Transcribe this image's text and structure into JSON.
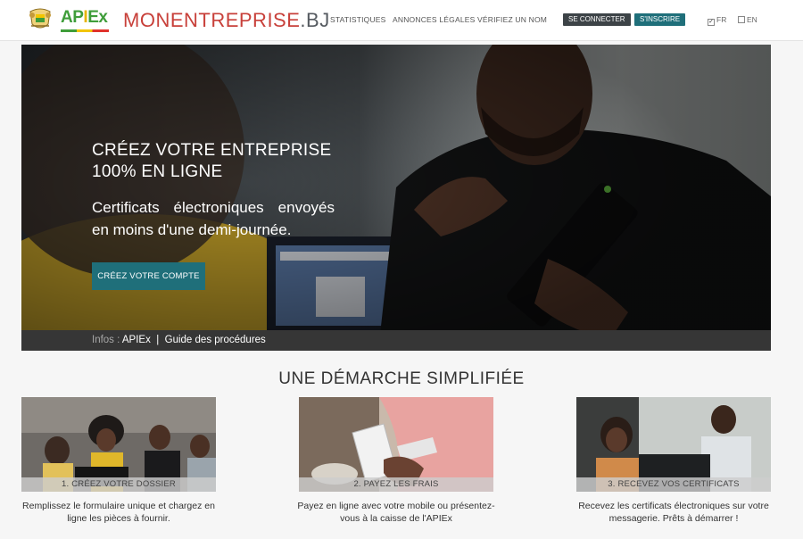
{
  "header": {
    "partner_logo_text": "APIEx",
    "brand_main": "MONENTREPRISE",
    "brand_tld": ".BJ",
    "nav": [
      "STATISTIQUES",
      "ANNONCES LÉGALES",
      "VÉRIFIEZ UN NOM"
    ],
    "login_label": "SE CONNECTER",
    "signup_label": "S'INSCRIRE",
    "lang_fr": "FR",
    "lang_en": "EN",
    "lang_fr_checked": true
  },
  "hero": {
    "title_line1": "CRÉEZ VOTRE ENTREPRISE",
    "title_line2": "100% EN LIGNE",
    "subtitle": "Certificats électroniques envoyés en moins d'une demi-journée.",
    "cta_label": "CRÉEZ VOTRE COMPTE",
    "info_prefix": "Infos :",
    "info_link1": "APIEx",
    "info_sep": "|",
    "info_link2": "Guide des procédures"
  },
  "steps": {
    "title": "UNE DÉMARCHE SIMPLIFIÉE",
    "items": [
      {
        "caption": "1. CRÉEZ VOTRE DOSSIER",
        "text": "Remplissez le formulaire unique et chargez en ligne les pièces à fournir."
      },
      {
        "caption": "2. PAYEZ LES FRAIS",
        "text": "Payez en ligne avec votre mobile ou présentez-vous à la caisse de l'APIEx"
      },
      {
        "caption": "3. RECEVEZ VOS CERTIFICATS",
        "text": "Recevez les certificats électroniques sur votre messagerie. Prêts à démarrer !"
      }
    ]
  },
  "colors": {
    "brand_red": "#c8403a",
    "teal": "#1f6f7a",
    "dark_button": "#3d4347",
    "apiex_green": "#3f9d3a",
    "apiex_yellow": "#e8b400"
  }
}
